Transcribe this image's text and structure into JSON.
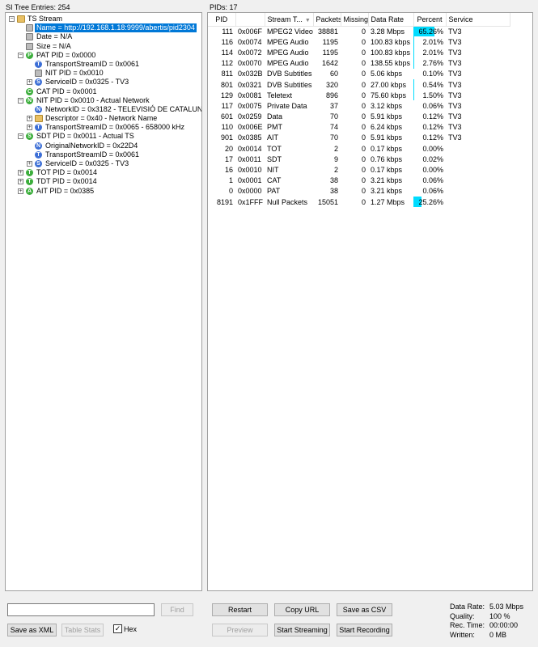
{
  "tree_header": "SI Tree Entries: 254",
  "pids_header": "PIDs: 17",
  "tree": [
    {
      "depth": 0,
      "toggle": "−",
      "icon": "folder",
      "letter": "",
      "color": "",
      "label": "TS Stream"
    },
    {
      "depth": 1,
      "toggle": "",
      "icon": "square",
      "letter": "",
      "color": "",
      "label": "Name = http://192.168.1.18:9999/abertis/pid2304",
      "selected": true
    },
    {
      "depth": 1,
      "toggle": "",
      "icon": "square",
      "letter": "",
      "color": "",
      "label": "Date = N/A"
    },
    {
      "depth": 1,
      "toggle": "",
      "icon": "square",
      "letter": "",
      "color": "",
      "label": "Size = N/A"
    },
    {
      "depth": 1,
      "toggle": "−",
      "icon": "circle",
      "letter": "P",
      "color": "#3cae3c",
      "label": "PAT PID = 0x0000"
    },
    {
      "depth": 2,
      "toggle": "",
      "icon": "circle",
      "letter": "T",
      "color": "#3d6fd6",
      "label": "TransportStreamID = 0x0061"
    },
    {
      "depth": 2,
      "toggle": "",
      "icon": "square",
      "letter": "",
      "color": "",
      "label": "NIT PID = 0x0010"
    },
    {
      "depth": 2,
      "toggle": "+",
      "icon": "circle",
      "letter": "S",
      "color": "#3d6fd6",
      "label": "ServiceID = 0x0325 - TV3"
    },
    {
      "depth": 1,
      "toggle": "",
      "icon": "circle",
      "letter": "C",
      "color": "#3cae3c",
      "label": "CAT PID = 0x0001"
    },
    {
      "depth": 1,
      "toggle": "−",
      "icon": "circle",
      "letter": "N",
      "color": "#3cae3c",
      "label": "NIT PID = 0x0010 - Actual Network"
    },
    {
      "depth": 2,
      "toggle": "",
      "icon": "circle",
      "letter": "N",
      "color": "#3d6fd6",
      "label": "NetworkID = 0x3182 - TELEVISIÓ DE CATALUNYA"
    },
    {
      "depth": 2,
      "toggle": "+",
      "icon": "folder",
      "letter": "",
      "color": "",
      "label": "Descriptor = 0x40 - Network Name"
    },
    {
      "depth": 2,
      "toggle": "+",
      "icon": "circle",
      "letter": "T",
      "color": "#3d6fd6",
      "label": "TransportStreamID = 0x0065 - 658000 kHz"
    },
    {
      "depth": 1,
      "toggle": "−",
      "icon": "circle",
      "letter": "S",
      "color": "#3cae3c",
      "label": "SDT PID = 0x0011 - Actual TS"
    },
    {
      "depth": 2,
      "toggle": "",
      "icon": "circle",
      "letter": "N",
      "color": "#3d6fd6",
      "label": "OriginalNetworkID = 0x22D4"
    },
    {
      "depth": 2,
      "toggle": "",
      "icon": "circle",
      "letter": "T",
      "color": "#3d6fd6",
      "label": "TransportStreamID = 0x0061"
    },
    {
      "depth": 2,
      "toggle": "+",
      "icon": "circle",
      "letter": "S",
      "color": "#3d6fd6",
      "label": "ServiceID = 0x0325 - TV3"
    },
    {
      "depth": 1,
      "toggle": "+",
      "icon": "circle",
      "letter": "T",
      "color": "#3cae3c",
      "label": "TOT PID = 0x0014"
    },
    {
      "depth": 1,
      "toggle": "+",
      "icon": "circle",
      "letter": "T",
      "color": "#3cae3c",
      "label": "TDT PID = 0x0014"
    },
    {
      "depth": 1,
      "toggle": "+",
      "icon": "circle",
      "letter": "A",
      "color": "#3cae3c",
      "label": "AIT PID = 0x0385"
    }
  ],
  "table": {
    "columns": [
      "PID",
      "",
      "Stream T...",
      "Packets",
      "Missing",
      "Data Rate",
      "Percent",
      "Service"
    ],
    "rows": [
      {
        "pid": "111",
        "hex": "0x006F",
        "type": "MPEG2 Video",
        "packets": "38881",
        "missing": "0",
        "rate": "3.28 Mbps",
        "percent": "65.26%",
        "frac": 0.6526,
        "service": "TV3"
      },
      {
        "pid": "116",
        "hex": "0x0074",
        "type": "MPEG Audio",
        "packets": "1195",
        "missing": "0",
        "rate": "100.83 kbps",
        "percent": "2.01%",
        "frac": 0.0201,
        "service": "TV3"
      },
      {
        "pid": "114",
        "hex": "0x0072",
        "type": "MPEG Audio",
        "packets": "1195",
        "missing": "0",
        "rate": "100.83 kbps",
        "percent": "2.01%",
        "frac": 0.0201,
        "service": "TV3"
      },
      {
        "pid": "112",
        "hex": "0x0070",
        "type": "MPEG Audio",
        "packets": "1642",
        "missing": "0",
        "rate": "138.55 kbps",
        "percent": "2.76%",
        "frac": 0.0276,
        "service": "TV3"
      },
      {
        "pid": "811",
        "hex": "0x032B",
        "type": "DVB Subtitles",
        "packets": "60",
        "missing": "0",
        "rate": "5.06 kbps",
        "percent": "0.10%",
        "frac": 0.001,
        "service": "TV3"
      },
      {
        "pid": "801",
        "hex": "0x0321",
        "type": "DVB Subtitles",
        "packets": "320",
        "missing": "0",
        "rate": "27.00 kbps",
        "percent": "0.54%",
        "frac": 0.0054,
        "service": "TV3"
      },
      {
        "pid": "129",
        "hex": "0x0081",
        "type": "Teletext",
        "packets": "896",
        "missing": "0",
        "rate": "75.60 kbps",
        "percent": "1.50%",
        "frac": 0.015,
        "service": "TV3"
      },
      {
        "pid": "117",
        "hex": "0x0075",
        "type": "Private Data",
        "packets": "37",
        "missing": "0",
        "rate": "3.12 kbps",
        "percent": "0.06%",
        "frac": 0.0006,
        "service": "TV3"
      },
      {
        "pid": "601",
        "hex": "0x0259",
        "type": "Data",
        "packets": "70",
        "missing": "0",
        "rate": "5.91 kbps",
        "percent": "0.12%",
        "frac": 0.0012,
        "service": "TV3"
      },
      {
        "pid": "110",
        "hex": "0x006E",
        "type": "PMT",
        "packets": "74",
        "missing": "0",
        "rate": "6.24 kbps",
        "percent": "0.12%",
        "frac": 0.0012,
        "service": "TV3"
      },
      {
        "pid": "901",
        "hex": "0x0385",
        "type": "AIT",
        "packets": "70",
        "missing": "0",
        "rate": "5.91 kbps",
        "percent": "0.12%",
        "frac": 0.0012,
        "service": "TV3"
      },
      {
        "pid": "20",
        "hex": "0x0014",
        "type": "TOT",
        "packets": "2",
        "missing": "0",
        "rate": "0.17 kbps",
        "percent": "0.00%",
        "frac": 0,
        "service": ""
      },
      {
        "pid": "17",
        "hex": "0x0011",
        "type": "SDT",
        "packets": "9",
        "missing": "0",
        "rate": "0.76 kbps",
        "percent": "0.02%",
        "frac": 0.0002,
        "service": ""
      },
      {
        "pid": "16",
        "hex": "0x0010",
        "type": "NIT",
        "packets": "2",
        "missing": "0",
        "rate": "0.17 kbps",
        "percent": "0.00%",
        "frac": 0,
        "service": ""
      },
      {
        "pid": "1",
        "hex": "0x0001",
        "type": "CAT",
        "packets": "38",
        "missing": "0",
        "rate": "3.21 kbps",
        "percent": "0.06%",
        "frac": 0.0006,
        "service": ""
      },
      {
        "pid": "0",
        "hex": "0x0000",
        "type": "PAT",
        "packets": "38",
        "missing": "0",
        "rate": "3.21 kbps",
        "percent": "0.06%",
        "frac": 0.0006,
        "service": ""
      },
      {
        "pid": "8191",
        "hex": "0x1FFF",
        "type": "Null Packets",
        "packets": "15051",
        "missing": "0",
        "rate": "1.27 Mbps",
        "percent": "25.26%",
        "frac": 0.2526,
        "service": ""
      }
    ]
  },
  "find": {
    "value": "",
    "button": "Find"
  },
  "left_buttons": {
    "save_xml": "Save as XML",
    "table_stats": "Table Stats",
    "hex_label": "Hex",
    "hex_checked": "✓"
  },
  "buttons": {
    "restart": "Restart",
    "copy_url": "Copy URL",
    "save_csv": "Save as CSV",
    "preview": "Preview",
    "start_streaming": "Start Streaming",
    "start_recording": "Start Recording"
  },
  "stats": [
    {
      "key": "Data Rate:",
      "value": "5.03 Mbps"
    },
    {
      "key": "Quality:",
      "value": "100 %"
    },
    {
      "key": "Rec. Time:",
      "value": "00:00:00"
    },
    {
      "key": "Written:",
      "value": "0 MB"
    }
  ],
  "colors": {
    "selection": "#0078d7",
    "percent_bar": "#00dcff",
    "green_node": "#3cae3c",
    "blue_node": "#3d6fd6"
  }
}
